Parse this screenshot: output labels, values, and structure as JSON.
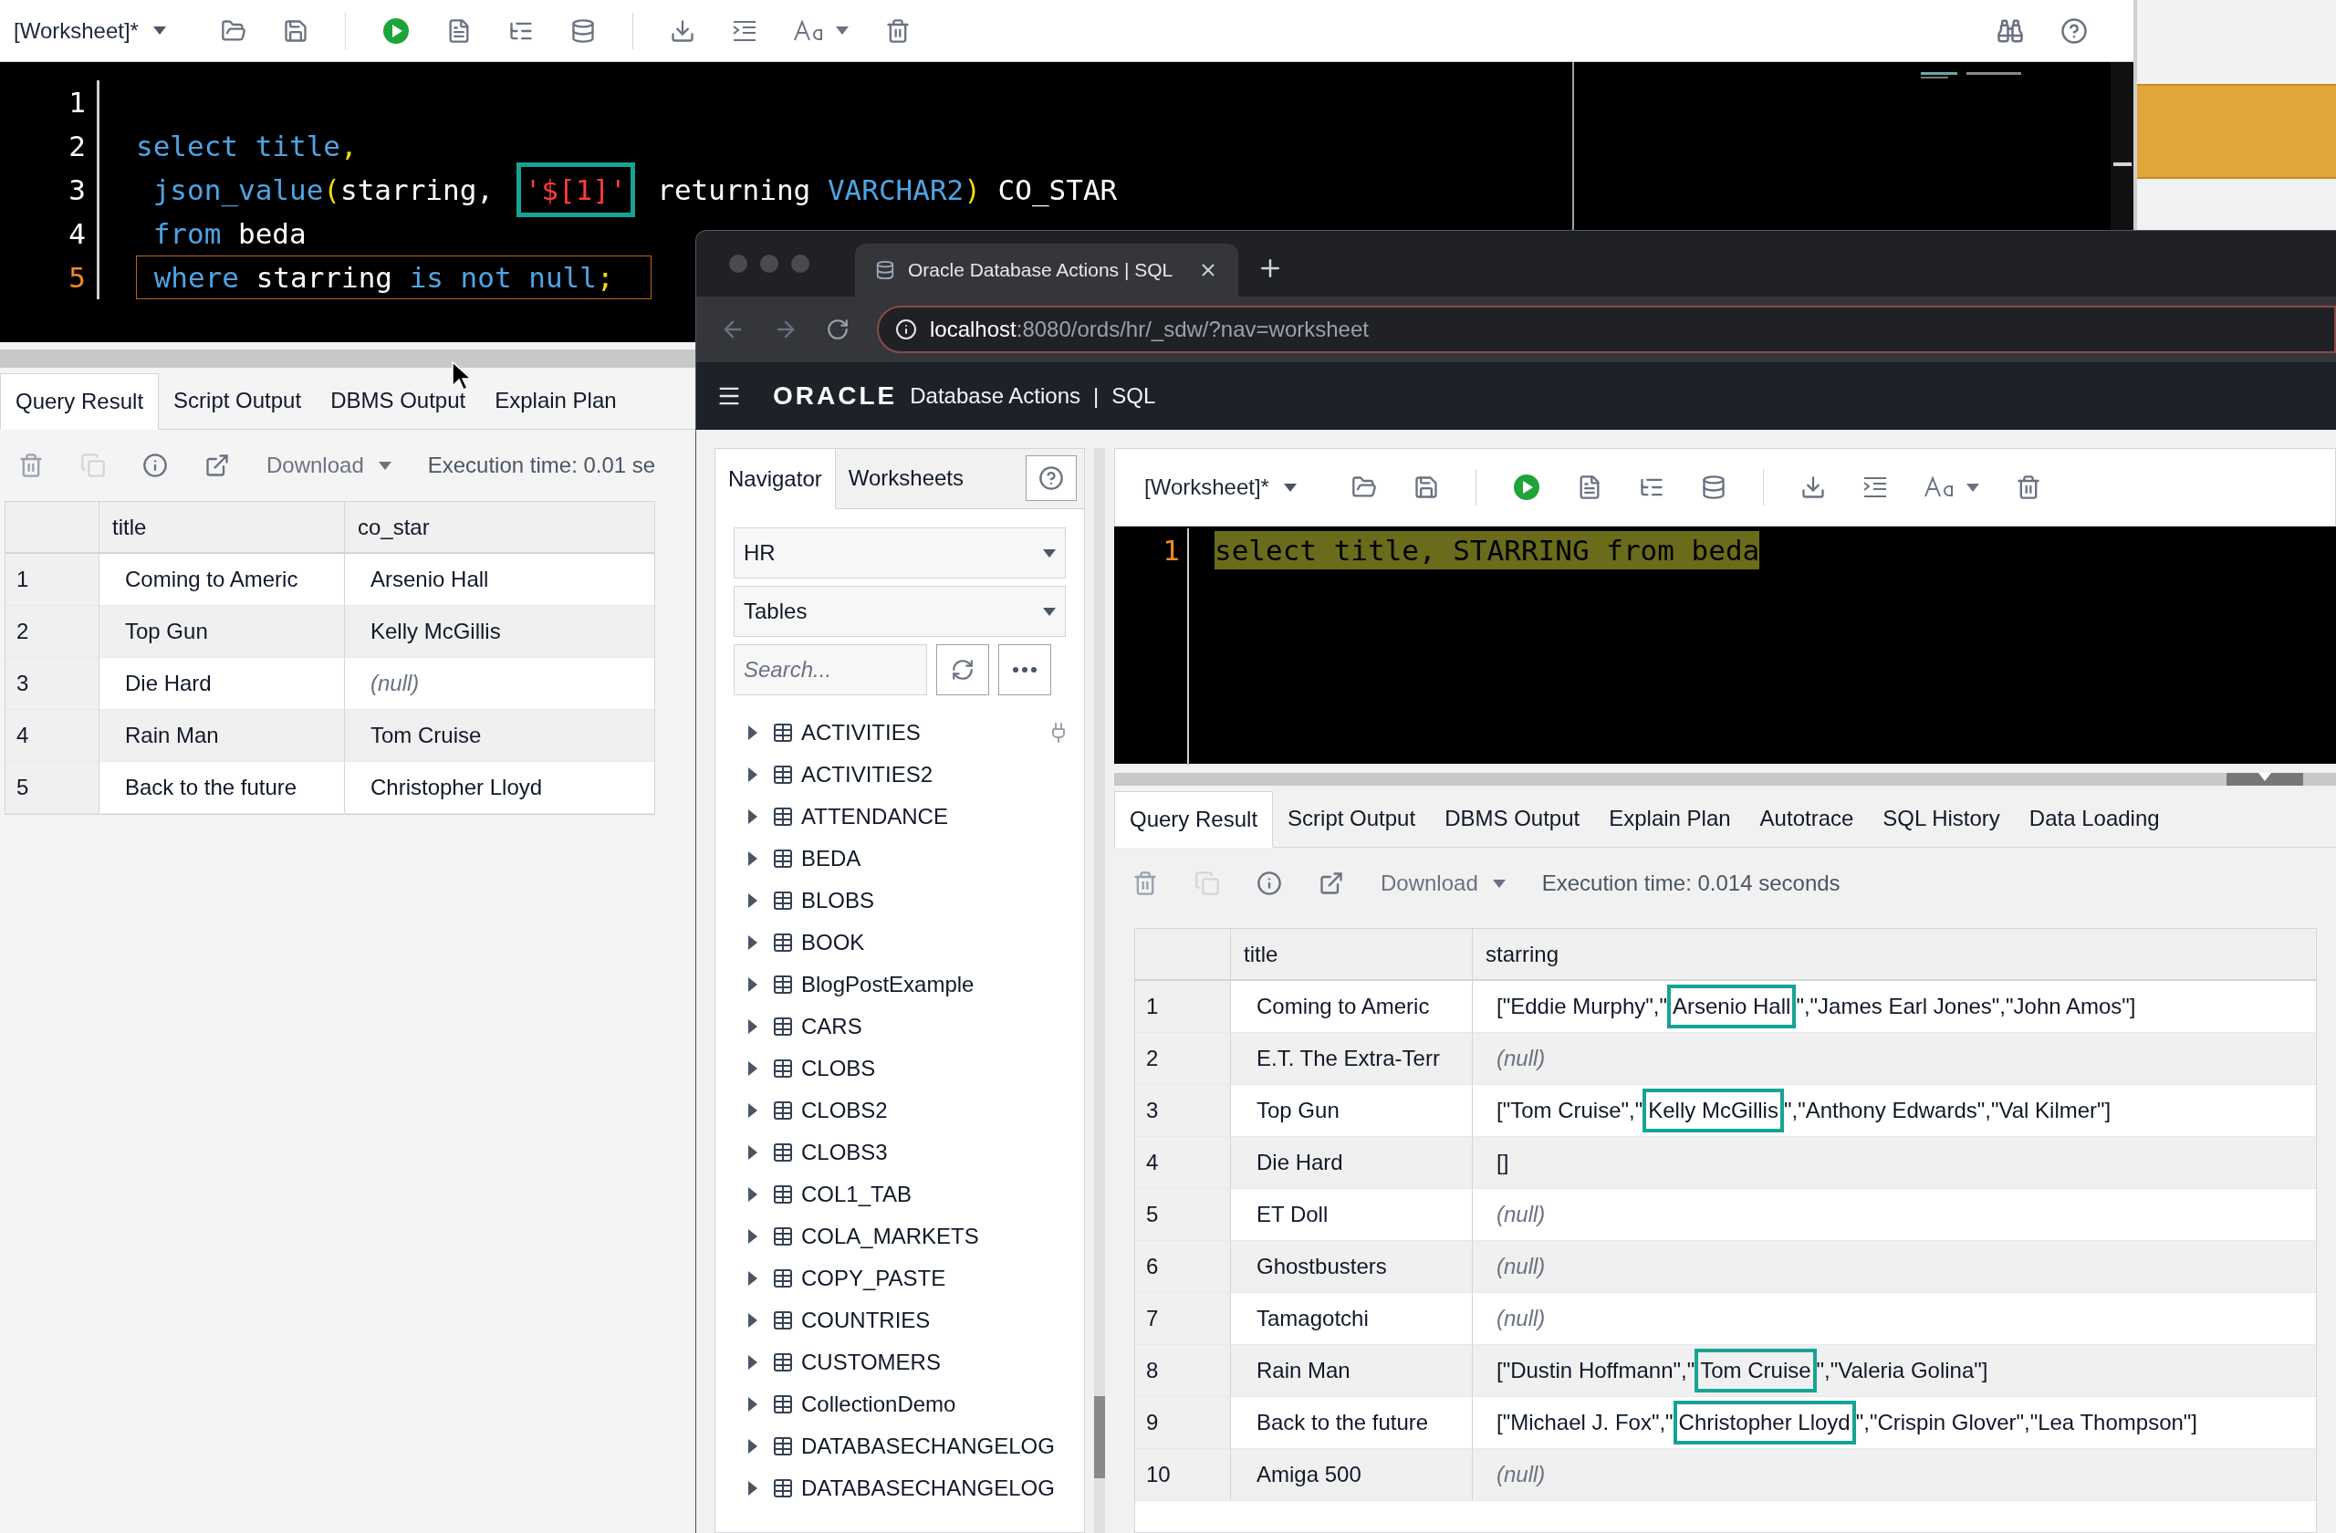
{
  "back_window": {
    "worksheet": "[Worksheet]*",
    "editor": {
      "lines": [
        {
          "number": "1",
          "current": false
        },
        {
          "number": "2",
          "current": false,
          "tokens": [
            {
              "text": "select ",
              "kind": "keyword"
            },
            {
              "text": "title",
              "kind": "keyword"
            },
            {
              "text": ",",
              "kind": "punct"
            }
          ]
        },
        {
          "number": "3",
          "current": false,
          "tokens": [
            {
              "text": " json_value",
              "kind": "keyword",
              "boxed": false
            },
            {
              "text": "(",
              "kind": "punct",
              "boxed": false
            },
            {
              "text": "starring, ",
              "kind": "plain",
              "boxed": false
            },
            {
              "text": "'$[1]'",
              "kind": "string",
              "boxed": true
            },
            {
              "text": " returning ",
              "kind": "plain",
              "boxed": false
            },
            {
              "text": "VARCHAR2",
              "kind": "keyword",
              "boxed": false
            },
            {
              "text": ")",
              "kind": "punct",
              "boxed": false
            },
            {
              "text": " CO_STAR",
              "kind": "plain",
              "boxed": false
            }
          ]
        },
        {
          "number": "4",
          "current": false,
          "tokens": [
            {
              "text": " from",
              "kind": "keyword"
            },
            {
              "text": " beda",
              "kind": "plain"
            }
          ]
        },
        {
          "number": "5",
          "current": true,
          "tokens": [
            {
              "text": " where",
              "kind": "keyword"
            },
            {
              "text": " starring",
              "kind": "plain"
            },
            {
              "text": " is not null",
              "kind": "keyword"
            },
            {
              "text": ";",
              "kind": "punct"
            }
          ]
        }
      ]
    },
    "result_tabs": [
      {
        "label": "Query Result",
        "selected": true
      },
      {
        "label": "Script Output",
        "selected": false
      },
      {
        "label": "DBMS Output",
        "selected": false
      },
      {
        "label": "Explain Plan",
        "selected": false
      }
    ],
    "download": "Download",
    "execution_time": "Execution time: 0.01 se",
    "table": {
      "columns": [
        "title",
        "co_star"
      ],
      "rows": [
        {
          "number": "1",
          "title": "Coming to Americ",
          "co_star": {
            "text": "Arsenio Hall",
            "null": false
          }
        },
        {
          "number": "2",
          "title": "Top Gun",
          "co_star": {
            "text": "Kelly McGillis",
            "null": false
          }
        },
        {
          "number": "3",
          "title": "Die Hard",
          "co_star": {
            "text": "(null)",
            "null": true
          }
        },
        {
          "number": "4",
          "title": "Rain Man",
          "co_star": {
            "text": "Tom Cruise",
            "null": false
          }
        },
        {
          "number": "5",
          "title": "Back to the future",
          "co_star": {
            "text": "Christopher Lloyd",
            "null": false
          }
        }
      ]
    }
  },
  "browser": {
    "tab_title": "Oracle Database Actions | SQL",
    "url_host": "localhost",
    "url_path": ":8080/ords/hr/_sdw/?nav=worksheet",
    "header": {
      "brand": "ORACLE",
      "product": "Database Actions",
      "separator": "|",
      "page": "SQL"
    },
    "navigator": {
      "tabs": [
        {
          "label": "Navigator",
          "selected": true
        },
        {
          "label": "Worksheets",
          "selected": false
        }
      ],
      "schema": "HR",
      "object_type": "Tables",
      "search": {
        "placeholder": "Search..."
      },
      "items": [
        "ACTIVITIES",
        "ACTIVITIES2",
        "ATTENDANCE",
        "BEDA",
        "BLOBS",
        "BOOK",
        "BlogPostExample",
        "CARS",
        "CLOBS",
        "CLOBS2",
        "CLOBS3",
        "COL1_TAB",
        "COLA_MARKETS",
        "COPY_PASTE",
        "COUNTRIES",
        "CUSTOMERS",
        "CollectionDemo",
        "DATABASECHANGELOG",
        "DATABASECHANGELOG"
      ]
    },
    "worksheet": "[Worksheet]*",
    "editor": {
      "lines": [
        {
          "number": "1",
          "current": true,
          "selected": true,
          "text": "select title, STARRING from beda"
        }
      ]
    },
    "result_tabs": [
      {
        "label": "Query Result",
        "selected": true
      },
      {
        "label": "Script Output",
        "selected": false
      },
      {
        "label": "DBMS Output",
        "selected": false
      },
      {
        "label": "Explain Plan",
        "selected": false
      },
      {
        "label": "Autotrace",
        "selected": false
      },
      {
        "label": "SQL History",
        "selected": false
      },
      {
        "label": "Data Loading",
        "selected": false
      }
    ],
    "download": "Download",
    "execution_time": "Execution time: 0.014 seconds",
    "table": {
      "columns": [
        "title",
        "starring"
      ],
      "rows": [
        {
          "number": "1",
          "title": "Coming to Americ",
          "starring": {
            "null": false,
            "parts": [
              {
                "text": "[\"Eddie Murphy\",\"",
                "boxed": false
              },
              {
                "text": "Arsenio Hall",
                "boxed": true
              },
              {
                "text": "\",\"James Earl Jones\",\"John Amos\"]",
                "boxed": false
              }
            ]
          }
        },
        {
          "number": "2",
          "title": "E.T. The Extra-Terr",
          "starring": {
            "null": true,
            "text": "(null)"
          }
        },
        {
          "number": "3",
          "title": "Top Gun",
          "starring": {
            "null": false,
            "parts": [
              {
                "text": "[\"Tom Cruise\",\"",
                "boxed": false
              },
              {
                "text": "Kelly McGillis",
                "boxed": true
              },
              {
                "text": "\",\"Anthony Edwards\",\"Val Kilmer\"]",
                "boxed": false
              }
            ]
          }
        },
        {
          "number": "4",
          "title": "Die Hard",
          "starring": {
            "null": false,
            "text": "[]"
          }
        },
        {
          "number": "5",
          "title": "ET Doll",
          "starring": {
            "null": true,
            "text": "(null)"
          }
        },
        {
          "number": "6",
          "title": "Ghostbusters",
          "starring": {
            "null": true,
            "text": "(null)"
          }
        },
        {
          "number": "7",
          "title": "Tamagotchi",
          "starring": {
            "null": true,
            "text": "(null)"
          }
        },
        {
          "number": "8",
          "title": "Rain Man",
          "starring": {
            "null": false,
            "parts": [
              {
                "text": "[\"Dustin Hoffmann\",\"",
                "boxed": false
              },
              {
                "text": "Tom Cruise",
                "boxed": true
              },
              {
                "text": "\",\"Valeria Golina\"]",
                "boxed": false
              }
            ]
          }
        },
        {
          "number": "9",
          "title": "Back to the future",
          "starring": {
            "null": false,
            "parts": [
              {
                "text": "[\"Michael J. Fox\",\"",
                "boxed": false
              },
              {
                "text": "Christopher Lloyd",
                "boxed": true
              },
              {
                "text": "\",\"Crispin Glover\",\"Lea Thompson\"]",
                "boxed": false
              }
            ]
          }
        },
        {
          "number": "10",
          "title": "Amiga 500",
          "starring": {
            "null": true,
            "text": "(null)"
          }
        }
      ]
    }
  }
}
